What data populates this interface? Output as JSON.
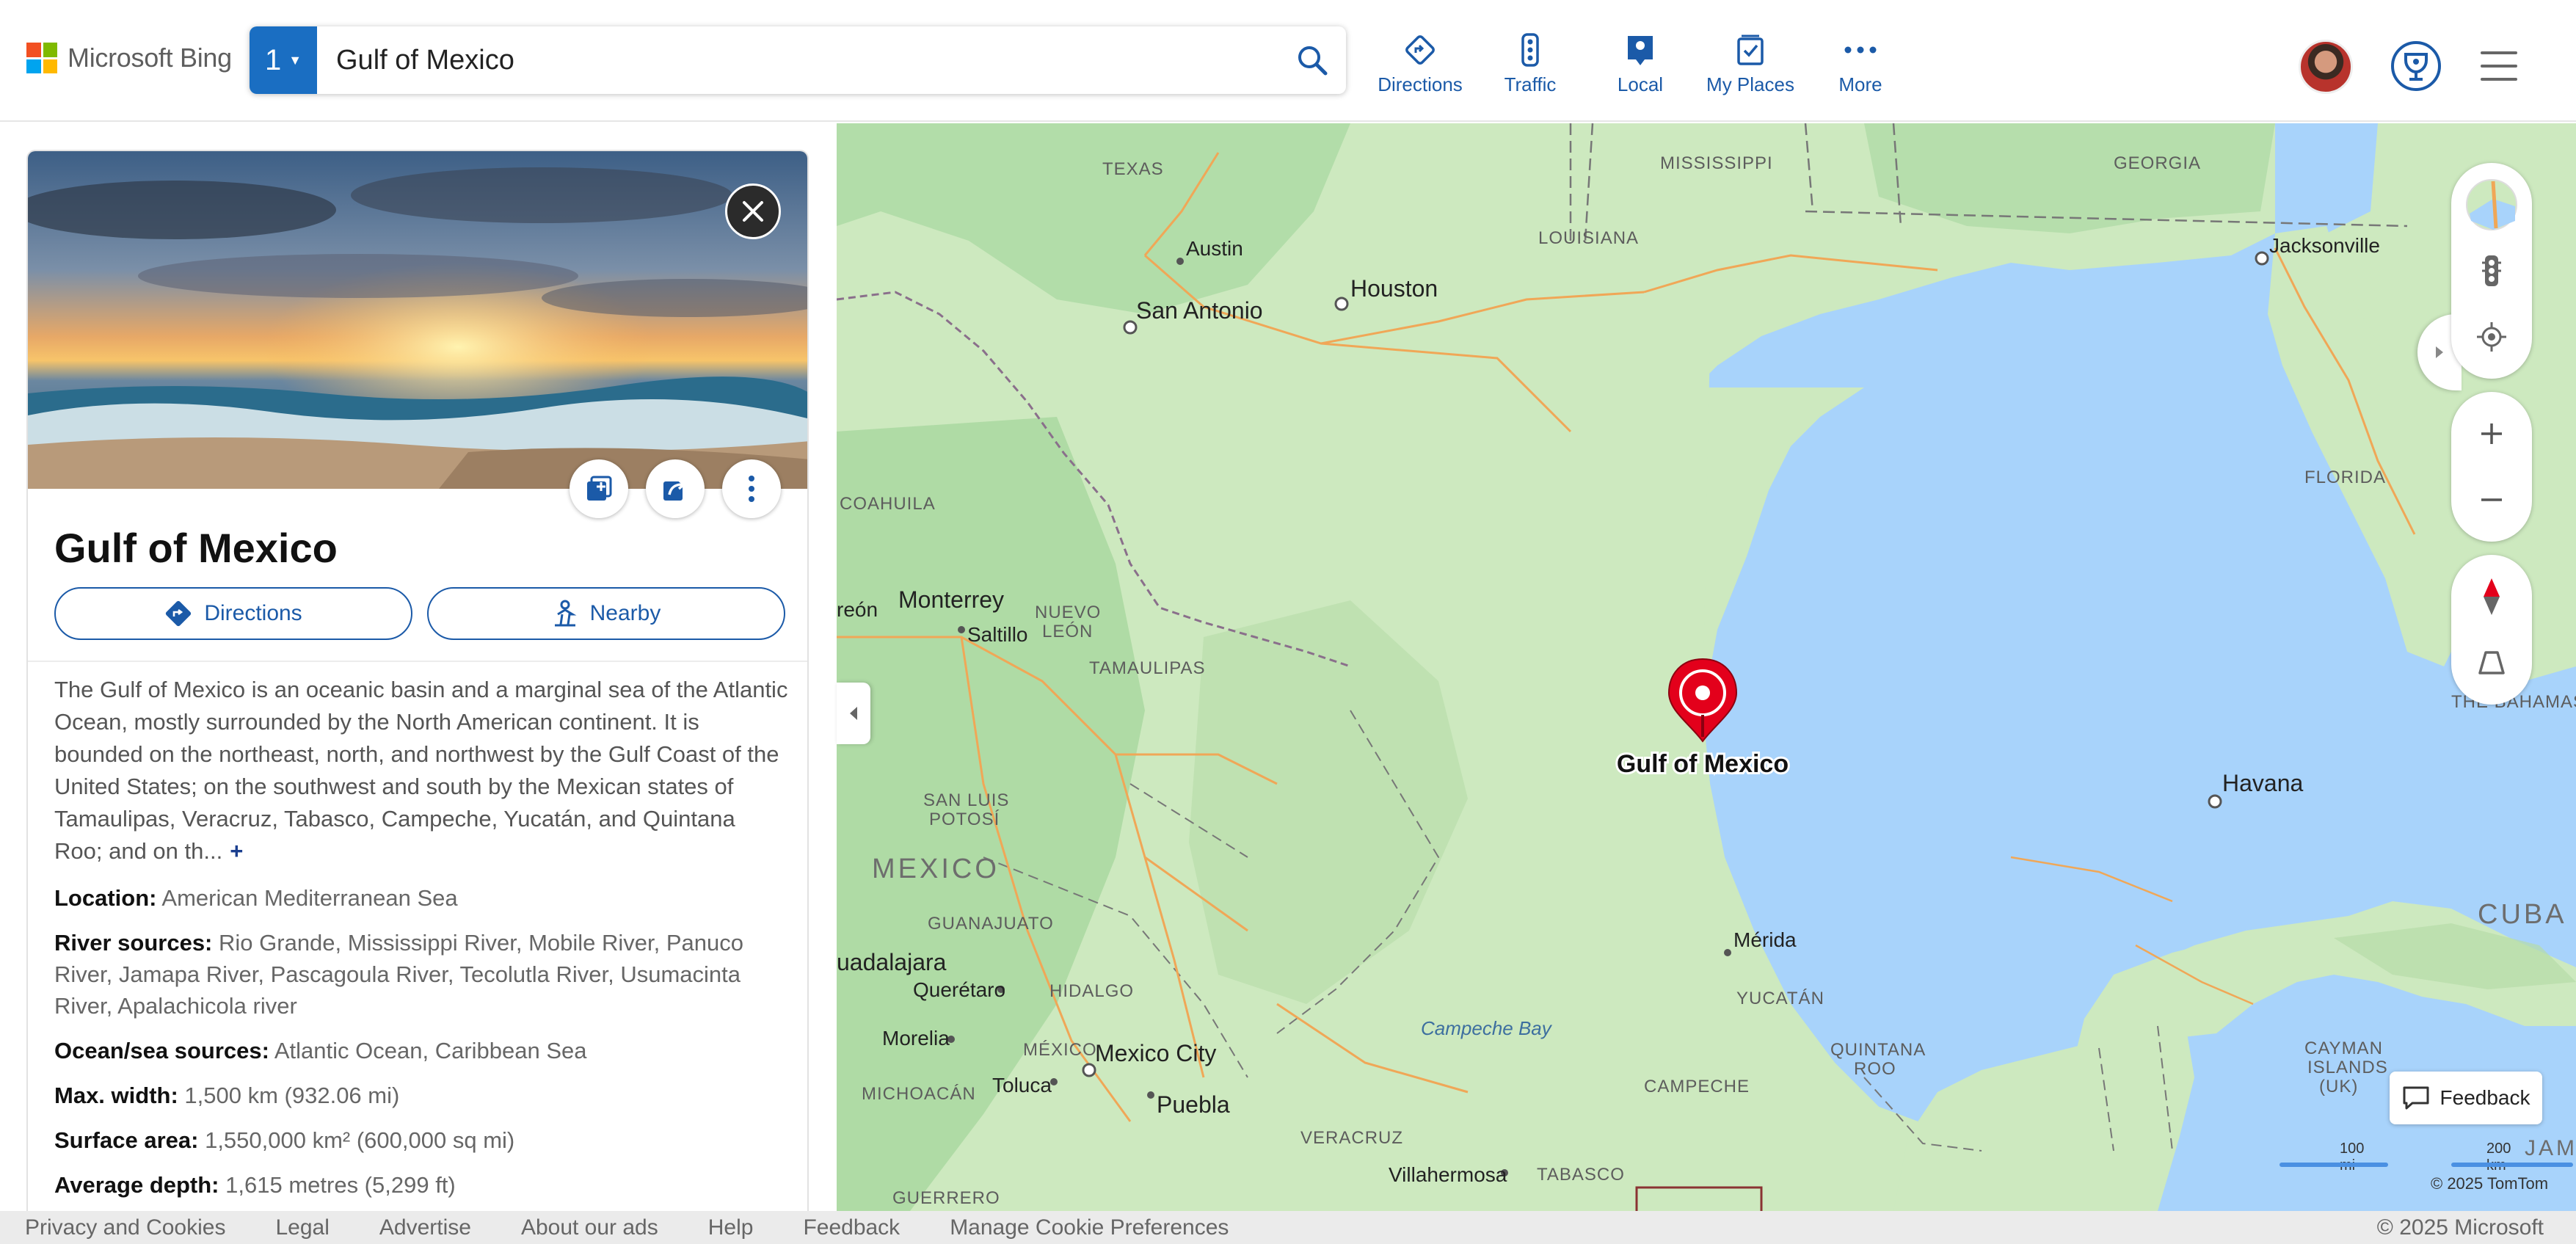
{
  "header": {
    "logo_text": "Microsoft Bing",
    "search_tab_number": "1",
    "search_query": "Gulf of Mexico",
    "nav": [
      {
        "label": "Directions",
        "icon": "directions-icon"
      },
      {
        "label": "Traffic",
        "icon": "traffic-icon"
      },
      {
        "label": "Local",
        "icon": "local-icon"
      },
      {
        "label": "My Places",
        "icon": "my-places-icon"
      },
      {
        "label": "More",
        "icon": "more-icon"
      }
    ]
  },
  "card": {
    "title": "Gulf of Mexico",
    "directions_label": "Directions",
    "nearby_label": "Nearby",
    "description": "The Gulf of Mexico is an oceanic basin and a marginal sea of the Atlantic Ocean, mostly surrounded by the North American continent. It is bounded on the northeast, north, and northwest by the Gulf Coast of the United States; on the southwest and south by the Mexican states of Tamaulipas, Veracruz, Tabasco, Campeche, Yucatán, and Quintana Roo; and on th...",
    "more_symbol": "+",
    "facts": [
      {
        "label": "Location:",
        "value": "American Mediterranean Sea"
      },
      {
        "label": "River sources:",
        "value": "Rio Grande, Mississippi River, Mobile River, Panuco River, Jamapa River, Pascagoula River, Tecolutla River, Usumacinta River, Apalachicola river"
      },
      {
        "label": "Ocean/sea sources:",
        "value": "Atlantic Ocean, Caribbean Sea"
      },
      {
        "label": "Max. width:",
        "value": "1,500 km (932.06 mi)"
      },
      {
        "label": "Surface area:",
        "value": "1,550,000 km² (600,000 sq mi)"
      },
      {
        "label": "Average depth:",
        "value": "1,615 metres (5,299 ft)"
      }
    ]
  },
  "map": {
    "pin_label": "Gulf of Mexico",
    "states": [
      "TEXAS",
      "MISSISSIPPI",
      "LOUISIANA",
      "GEORGIA",
      "FLORIDA",
      "COAHUILA",
      "NUEVO LEÓN",
      "TAMAULIPAS",
      "SAN LUIS POTOSÍ",
      "GUANAJUATO",
      "HIDALGO",
      "MICHOACÁN",
      "MÉXICO",
      "VERACRUZ",
      "GUERRERO",
      "TABASCO",
      "CAMPECHE",
      "YUCATÁN",
      "QUINTANA ROO",
      "CAYMAN ISLANDS (UK)",
      "THE BAHAMAS"
    ],
    "countries": [
      "MEXICO",
      "CUBA",
      "JAMAICA"
    ],
    "cities": [
      "Austin",
      "Houston",
      "San Antonio",
      "Jacksonville",
      "Monterrey",
      "Saltillo",
      "reón",
      "Havana",
      "Mérida",
      "uadalajara",
      "Querétaro",
      "Morelia",
      "Mexico City",
      "Toluca",
      "Puebla",
      "Villahermosa"
    ],
    "water_labels": [
      "Campeche Bay"
    ],
    "scale": {
      "a": "100 mi",
      "b": "200 km"
    },
    "copyright": "© 2025 TomTom",
    "feedback_label": "Feedback"
  },
  "footer": {
    "links": [
      "Privacy and Cookies",
      "Legal",
      "Advertise",
      "About our ads",
      "Help",
      "Feedback",
      "Manage Cookie Preferences"
    ],
    "copyright": "© 2025 Microsoft"
  },
  "colors": {
    "accent": "#1b5aa8",
    "water": "#a8d3fb",
    "land": "#cde9bf",
    "pin": "#e3001b"
  }
}
